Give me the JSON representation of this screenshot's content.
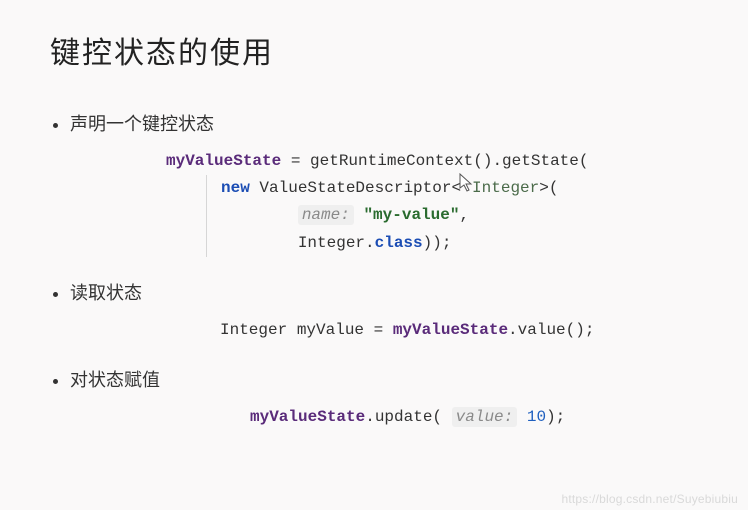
{
  "title": "键控状态的使用",
  "bullets": {
    "b1": "声明一个键控状态",
    "b2": "读取状态",
    "b3": "对状态赋值"
  },
  "code1": {
    "var": "myValueState",
    "assign": " = getRuntimeContext().getState(",
    "newKw": "new",
    "ctor": " ValueStateDescriptor<",
    "generic": "Integer",
    "ctorEnd": ">(",
    "hintName": "name:",
    "strVal": "\"my-value\"",
    "comma": ",",
    "line4a": "Integer.",
    "classKw": "class",
    "line4b": "));"
  },
  "code2": {
    "full_a": "Integer myValue = ",
    "var": "myValueState",
    "full_b": ".value();"
  },
  "code3": {
    "var": "myValueState",
    "method": ".update(",
    "hintVal": "value:",
    "num": "10",
    "end": ");"
  },
  "watermark": "https://blog.csdn.net/Suyebiubiu"
}
